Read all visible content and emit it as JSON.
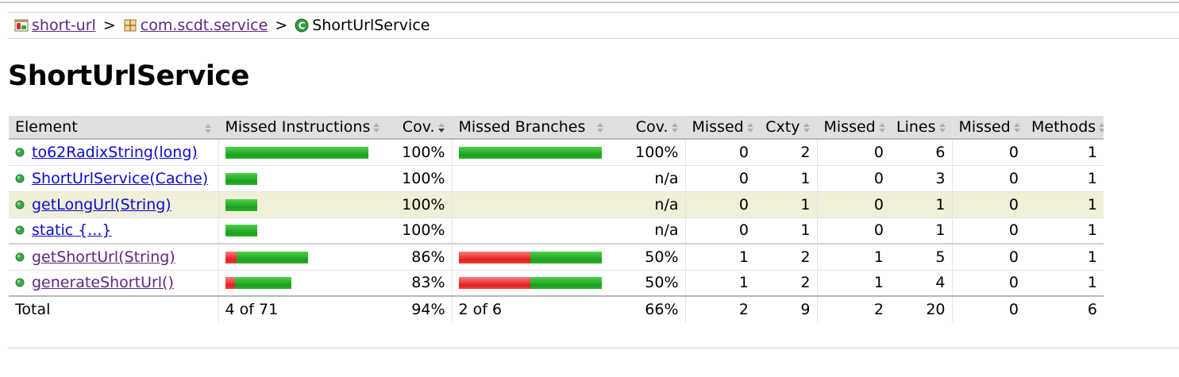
{
  "breadcrumb": {
    "project": "short-url",
    "package": "com.scdt.service",
    "current": "ShortUrlService",
    "separator": ">"
  },
  "page_title": "ShortUrlService",
  "table": {
    "headers": {
      "element": "Element",
      "missed_instructions": "Missed Instructions",
      "cov_instructions": "Cov.",
      "missed_branches": "Missed Branches",
      "cov_branches": "Cov.",
      "missed_cxty": "Missed",
      "cxty": "Cxty",
      "missed_lines": "Missed",
      "lines": "Lines",
      "missed_methods": "Missed",
      "methods": "Methods"
    },
    "rows": [
      {
        "element": "to62RadixString(long)",
        "visited": false,
        "instr_missed": 0.0,
        "instr_scale": 1.0,
        "instr_cov": "100%",
        "branch_missed": 0.0,
        "branch_scale": 1.0,
        "has_branch": true,
        "branch_cov": "100%",
        "missed_cxty": "0",
        "cxty": "2",
        "missed_lines": "0",
        "lines": "6",
        "missed_methods": "0",
        "methods": "1"
      },
      {
        "element": "ShortUrlService(Cache)",
        "visited": false,
        "instr_missed": 0.0,
        "instr_scale": 0.22,
        "instr_cov": "100%",
        "has_branch": false,
        "branch_cov": "n/a",
        "missed_cxty": "0",
        "cxty": "1",
        "missed_lines": "0",
        "lines": "3",
        "missed_methods": "0",
        "methods": "1"
      },
      {
        "element": "getLongUrl(String)",
        "visited": false,
        "instr_missed": 0.0,
        "instr_scale": 0.22,
        "instr_cov": "100%",
        "has_branch": false,
        "branch_cov": "n/a",
        "missed_cxty": "0",
        "cxty": "1",
        "missed_lines": "0",
        "lines": "1",
        "missed_methods": "0",
        "methods": "1"
      },
      {
        "element": "static {...}",
        "visited": false,
        "instr_missed": 0.0,
        "instr_scale": 0.22,
        "instr_cov": "100%",
        "has_branch": false,
        "branch_cov": "n/a",
        "missed_cxty": "0",
        "cxty": "1",
        "missed_lines": "0",
        "lines": "1",
        "missed_methods": "0",
        "methods": "1"
      },
      {
        "element": "getShortUrl(String)",
        "visited": true,
        "instr_missed": 0.13,
        "instr_scale": 0.58,
        "instr_cov": "86%",
        "branch_missed": 0.5,
        "branch_scale": 1.0,
        "has_branch": true,
        "branch_cov": "50%",
        "missed_cxty": "1",
        "cxty": "2",
        "missed_lines": "1",
        "lines": "5",
        "missed_methods": "0",
        "methods": "1"
      },
      {
        "element": "generateShortUrl()",
        "visited": true,
        "instr_missed": 0.15,
        "instr_scale": 0.46,
        "instr_cov": "83%",
        "branch_missed": 0.5,
        "branch_scale": 1.0,
        "has_branch": true,
        "branch_cov": "50%",
        "missed_cxty": "1",
        "cxty": "2",
        "missed_lines": "1",
        "lines": "4",
        "missed_methods": "0",
        "methods": "1"
      }
    ],
    "highlight_row": 2,
    "total": {
      "label": "Total",
      "instr": "4 of 71",
      "instr_cov": "94%",
      "branch": "2 of 6",
      "branch_cov": "66%",
      "missed_cxty": "2",
      "cxty": "9",
      "missed_lines": "2",
      "lines": "20",
      "missed_methods": "0",
      "methods": "6"
    }
  },
  "colors": {
    "covered": "#2bb52b",
    "missed": "#e02020",
    "link": "#0a0ad0",
    "visited_link": "#60257e",
    "highlight_row": "#f0f0d8",
    "header_bg": "#e0e0e0"
  },
  "icons": {
    "project": "report-icon",
    "package": "package-icon",
    "class": "class-icon",
    "method": "method-dot-icon",
    "sort": "sort-arrows-icon",
    "sort_desc": "sort-desc-icon"
  }
}
